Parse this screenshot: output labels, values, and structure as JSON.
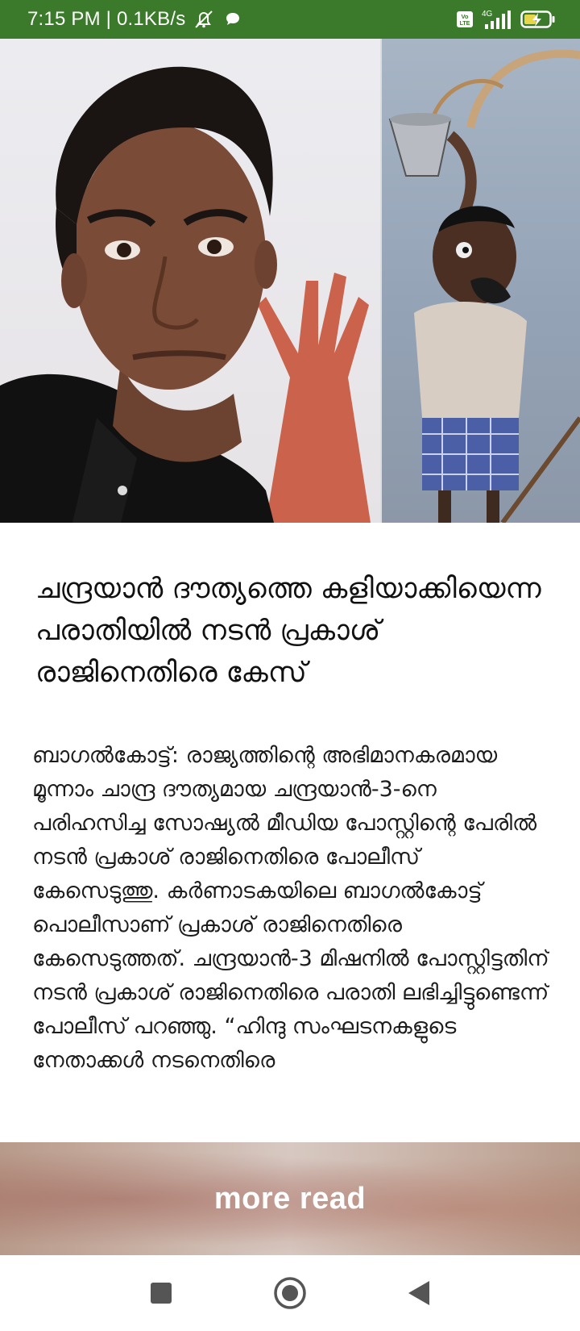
{
  "status_bar": {
    "time_speed": "7:15 PM | 0.1KB/s",
    "network": "4G",
    "volte": "Vo LTE",
    "background_color": "#3a7a2a"
  },
  "hero_image": {
    "left_panel": "actor-portrait",
    "right_panel": "cartoon-tea-pouring"
  },
  "article": {
    "headline": "ചന്ദ്രയാൻ ദൗത്യത്തെ കളിയാക്കിയെന്ന പരാതിയിൽ നടൻ പ്രകാശ് രാജിനെതിരെ കേസ്",
    "body": "ബാഗൽകോട്ട്: രാജ്യത്തിന്റെ അഭിമാനകരമായ മൂന്നാം ചാന്ദ്ര ദൗത്യമായ ചന്ദ്രയാൻ-3-നെ പരിഹസിച്ച സോഷ്യൽ മീഡിയ പോസ്റ്റിന്റെ പേരിൽ നടൻ പ്രകാശ് രാജിനെതിരെ പോലീസ് കേസെടുത്തു. കർണാടകയിലെ ബാഗൽകോട്ട് പൊലീസാണ് പ്രകാശ് രാജിനെതിരെ കേസെടുത്തത്. ചന്ദ്രയാൻ-3 മിഷനിൽ പോസ്റ്റിട്ടതിന് നടൻ പ്രകാശ് രാജിനെതിരെ പരാതി ലഭിച്ചിട്ടുണ്ടെന്ന് പോലീസ് പറഞ്ഞു. “ഹിന്ദു സംഘടനകളുടെ നേതാക്കൾ നടനെതിരെ"
  },
  "more_read": {
    "label": "more read"
  },
  "nav": {
    "recents": "square-icon",
    "home": "circle-icon",
    "back": "triangle-icon"
  }
}
